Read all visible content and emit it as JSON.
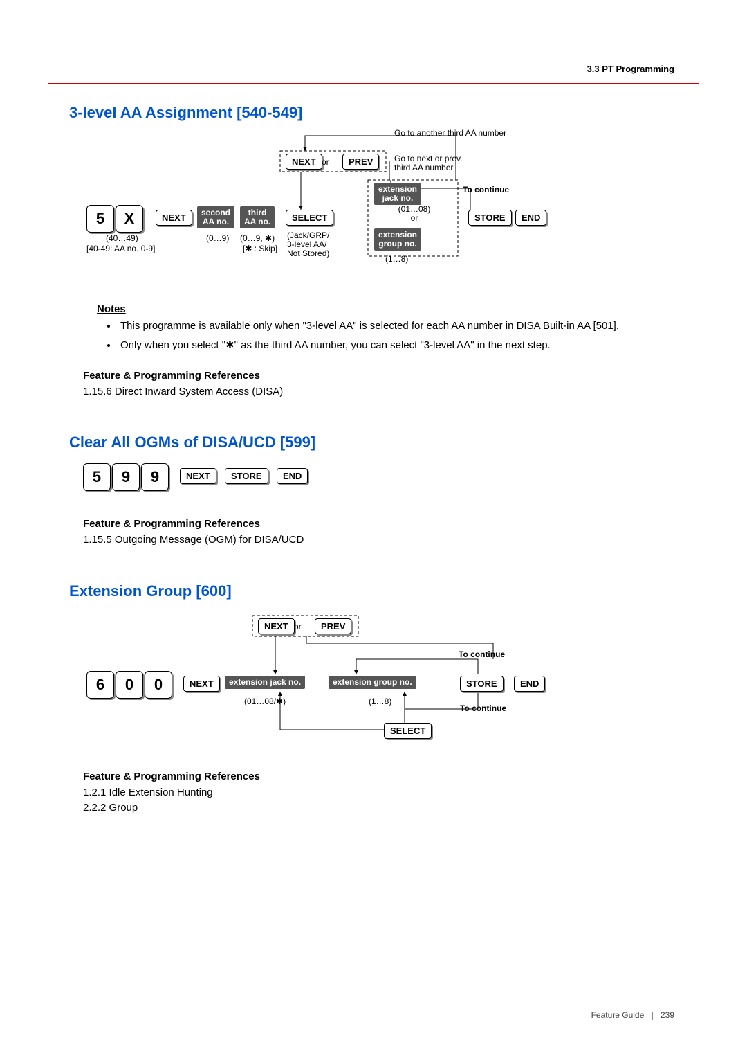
{
  "header": {
    "section": "3.3 PT Programming"
  },
  "s1": {
    "title": "3-level AA Assignment [540-549]",
    "top_note": "Go to another third AA number",
    "next": "NEXT",
    "or": "or",
    "prev": "PREV",
    "next_note": "Go to next or prev.\nthird AA number",
    "ext_jack": "extension\njack no.",
    "to_continue": "To continue",
    "key1": "5",
    "key2": "X",
    "next2": "NEXT",
    "second_aa": "second\nAA no.",
    "third_aa": "third\nAA no.",
    "select": "SELECT",
    "range1": "(01…08)\nor",
    "store": "STORE",
    "end": "END",
    "sub1": "(40…49)",
    "sub1b": "[40-49: AA no. 0-9]",
    "sub2": "(0…9)",
    "sub3": "(0…9, ✱)",
    "sub3b": "[✱ : Skip]",
    "sub4": "(Jack/GRP/\n3-level AA/\nNot Stored)",
    "ext_grp": "extension\ngroup no.",
    "range2": "(1…8)"
  },
  "notes_h": "Notes",
  "notes": [
    "This programme is available only when \"3-level AA\" is selected for each AA number in DISA Built-in AA [501].",
    "Only when you select \"✱\" as the third AA number, you can select \"3-level AA\" in the next step."
  ],
  "refs_h": "Feature & Programming References",
  "s1_refs": [
    "1.15.6 Direct Inward System Access (DISA)"
  ],
  "s2": {
    "title": "Clear All OGMs of DISA/UCD [599]",
    "k1": "5",
    "k2": "9",
    "k3": "9",
    "next": "NEXT",
    "store": "STORE",
    "end": "END"
  },
  "s2_refs": [
    "1.15.5 Outgoing Message (OGM) for DISA/UCD"
  ],
  "s3": {
    "title": "Extension Group [600]",
    "next": "NEXT",
    "or": "or",
    "prev": "PREV",
    "to_continue": "To continue",
    "k1": "6",
    "k2": "0",
    "k3": "0",
    "next2": "NEXT",
    "ext_jack": "extension jack no.",
    "ext_grp": "extension group no.",
    "store": "STORE",
    "end": "END",
    "sub1": "(01…08/✱)",
    "sub2": "(1…8)",
    "select": "SELECT"
  },
  "s3_refs": [
    "1.2.1 Idle Extension Hunting",
    "2.2.2 Group"
  ],
  "footer": {
    "guide": "Feature Guide",
    "page": "239"
  }
}
